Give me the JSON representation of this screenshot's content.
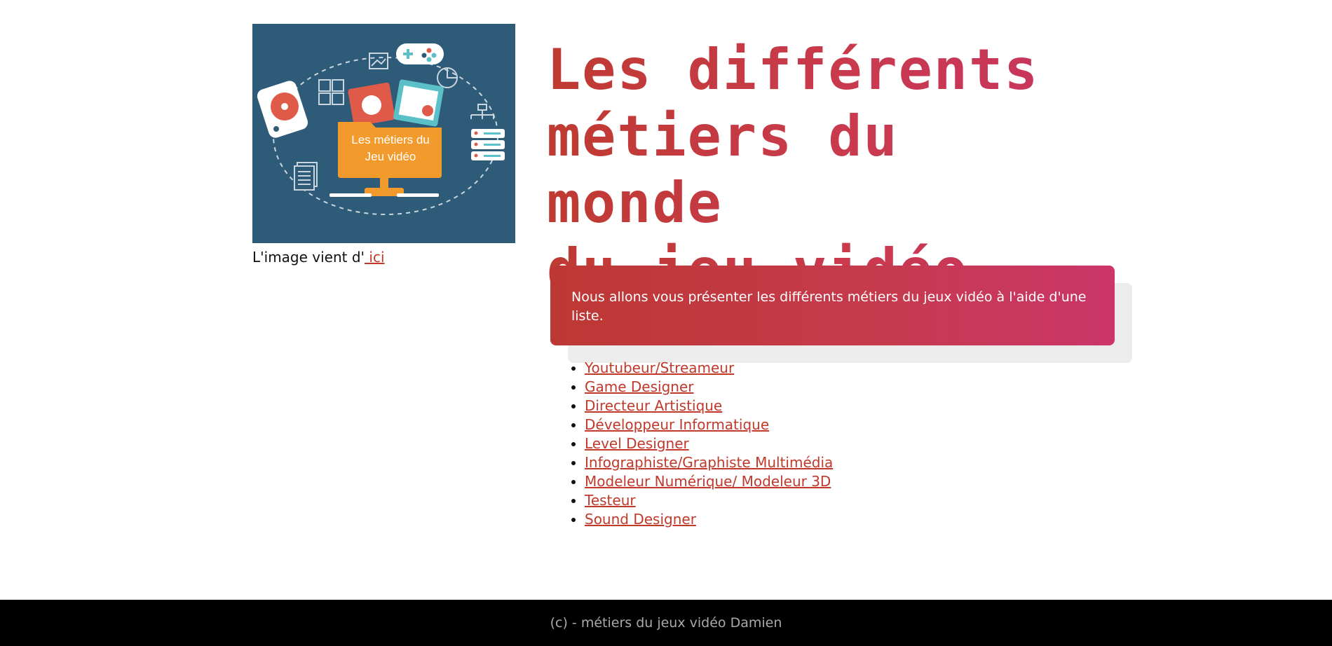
{
  "hero": {
    "folder_text_line1": "Les métiers du",
    "folder_text_line2": "Jeu vidéo",
    "bg_color": "#2e5b78",
    "folder_color": "#f39a2c"
  },
  "credit": {
    "prefix": "L'image vient d'",
    "link_label": " ici"
  },
  "title": {
    "line1": "Les différents",
    "line2": "métiers du monde",
    "line3": "du jeu vidéo"
  },
  "intro": {
    "text": "Nous allons vous présenter les différents métiers du jeux vidéo à l'aide d'une liste."
  },
  "jobs": [
    "Youtubeur/Streameur",
    "Game Designer",
    "Directeur Artistique",
    "Développeur Informatique",
    "Level Designer",
    "Infographiste/Graphiste Multimédia",
    "Modeleur Numérique/ Modeleur 3D",
    "Testeur",
    "Sound Designer"
  ],
  "footer": {
    "text": "(c) - métiers du jeux vidéo Damien"
  },
  "colors": {
    "accent": "#c0392b",
    "gradient_start": "#bd3834",
    "gradient_end": "#cb3569",
    "footer_bg": "#000000"
  }
}
